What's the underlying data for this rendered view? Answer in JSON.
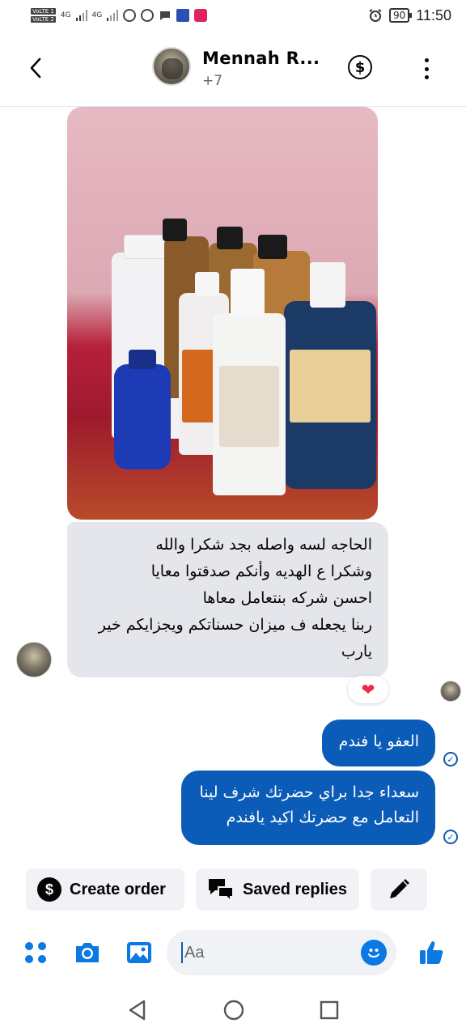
{
  "status_bar": {
    "volte1": "VoLTE 1",
    "volte2": "VoLTE 2",
    "network1": "4G",
    "network2": "4G",
    "battery": "90",
    "time": "11:50"
  },
  "header": {
    "contact_name": "Mennah R...",
    "subtitle": "+7"
  },
  "messages": {
    "incoming": {
      "lines": [
        "الحاجه لسه واصله بجد شكرا والله",
        "وشكرا ع الهديه وأنكم صدقتوا معايا",
        "احسن شركه بنتعامل معاها",
        "ربنا يجعله ف ميزان حسناتكم ويجزايكم خير",
        "يارب"
      ],
      "reaction": "❤"
    },
    "outgoing": [
      {
        "lines": [
          "العفو يا فندم"
        ]
      },
      {
        "lines": [
          "سعداء جدا براي حضرتك شرف لينا",
          "التعامل مع حضرتك اكيد يافندم"
        ]
      }
    ]
  },
  "quick_actions": {
    "create_order": "Create order",
    "saved_replies": "Saved replies"
  },
  "composer": {
    "placeholder": "Aa"
  },
  "colors": {
    "accent": "#0b5cb8",
    "incoming_bubble": "#e4e6eb",
    "reaction": "#f02849"
  }
}
